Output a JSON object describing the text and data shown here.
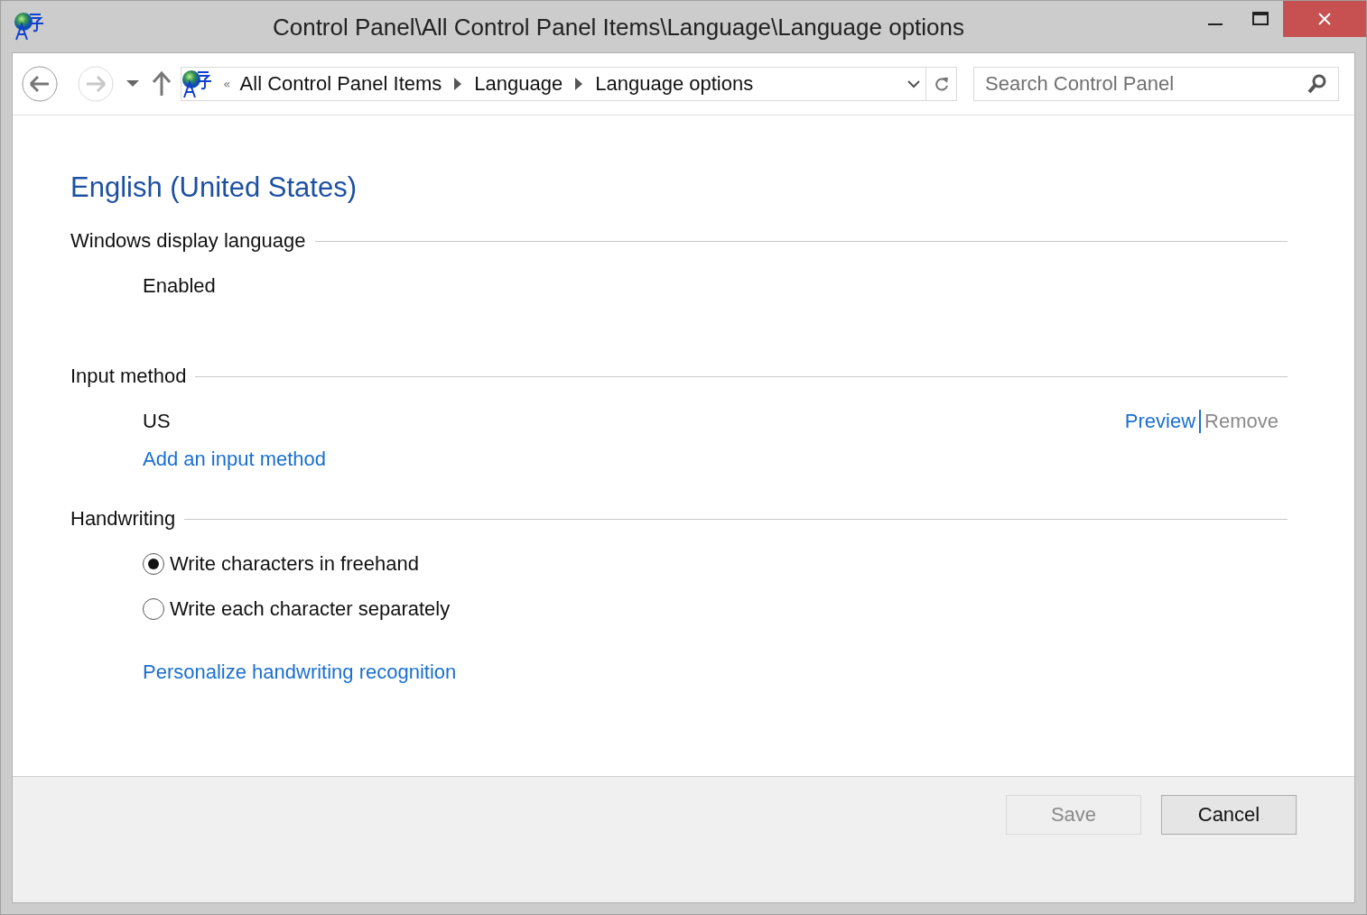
{
  "window": {
    "title": "Control Panel\\All Control Panel Items\\Language\\Language options"
  },
  "nav": {
    "back_disabled": false,
    "forward_disabled": true
  },
  "address_bar": {
    "overflow": "«",
    "crumbs": [
      "All Control Panel Items",
      "Language",
      "Language options"
    ]
  },
  "search": {
    "placeholder": "Search Control Panel"
  },
  "language": {
    "title": "English (United States)"
  },
  "sections": [
    {
      "kind": "status",
      "heading": "Windows display language",
      "status": "Enabled"
    },
    {
      "kind": "methods",
      "heading": "Input method",
      "methods": [
        {
          "name": "US",
          "actions": [
            {
              "label": "Preview",
              "disabled": false
            },
            {
              "label": "Remove",
              "disabled": true
            }
          ]
        }
      ],
      "add_link": "Add an input method"
    },
    {
      "kind": "radios",
      "heading": "Handwriting",
      "options": [
        {
          "label": "Write characters in freehand",
          "selected": true
        },
        {
          "label": "Write each character separately",
          "selected": false
        }
      ],
      "link": "Personalize handwriting recognition"
    }
  ],
  "buttons": [
    {
      "label": "Save",
      "disabled": true
    },
    {
      "label": "Cancel",
      "disabled": false
    }
  ]
}
